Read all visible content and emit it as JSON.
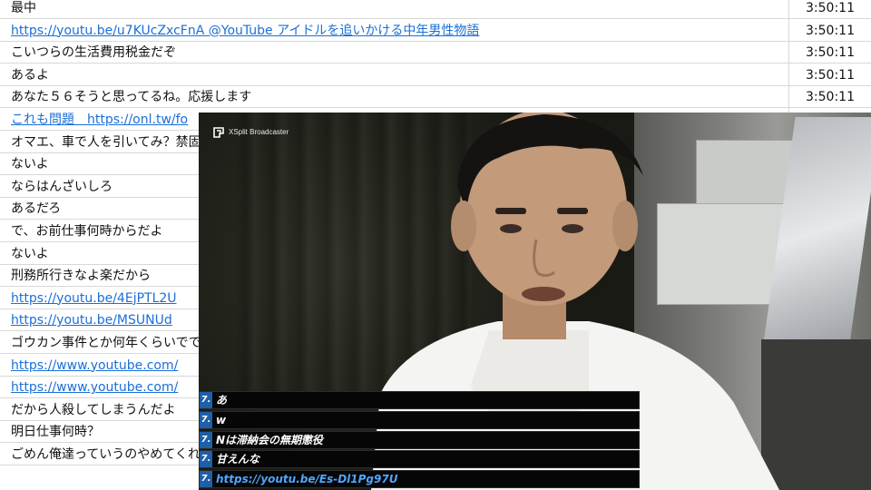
{
  "chat": {
    "rows": [
      {
        "text": "最中",
        "time": "3:50:11",
        "link": false
      },
      {
        "text": "https://youtu.be/u7KUcZxcFnA @YouTube アイドルを追いかける中年男性物語",
        "time": "3:50:11",
        "link": true
      },
      {
        "text": "こいつらの生活費用税金だぞ",
        "time": "3:50:11",
        "link": false
      },
      {
        "text": "あるよ",
        "time": "3:50:11",
        "link": false
      },
      {
        "text": "あなた５６そうと思ってるね。応援します",
        "time": "3:50:11",
        "link": false
      },
      {
        "text": "これも問題　https://onl.tw/fo",
        "time": "",
        "link": true
      },
      {
        "text": "オマエ、車で人を引いてみ？禁固",
        "time": "",
        "link": false
      },
      {
        "text": "ないよ",
        "time": "",
        "link": false
      },
      {
        "text": "ならはんざいしろ",
        "time": "",
        "link": false
      },
      {
        "text": "あるだろ",
        "time": "",
        "link": false
      },
      {
        "text": "で、お前仕事何時からだよ",
        "time": "",
        "link": false
      },
      {
        "text": "ないよ",
        "time": "",
        "link": false
      },
      {
        "text": "刑務所行きなよ楽だから",
        "time": "",
        "link": false
      },
      {
        "text": "https://youtu.be/4EjPTL2U",
        "time": "",
        "link": true
      },
      {
        "text": "https://youtu.be/MSUNUd",
        "time": "",
        "link": true
      },
      {
        "text": "ゴウカン事件とか何年くらいででて",
        "time": "",
        "link": false
      },
      {
        "text": "https://www.youtube.com/",
        "time": "",
        "link": true
      },
      {
        "text": "https://www.youtube.com/",
        "time": "",
        "link": true
      },
      {
        "text": "だから人殺してしまうんだよ",
        "time": "",
        "link": false
      },
      {
        "text": "明日仕事何時？",
        "time": "",
        "link": false
      },
      {
        "text": "ごめん俺達っていうのやめてくれない",
        "time": "",
        "link": false
      }
    ]
  },
  "video": {
    "watermark": "XSplit Broadcaster"
  },
  "live_comments": [
    {
      "text": "あ",
      "link": false
    },
    {
      "text": "w",
      "link": false
    },
    {
      "text": "Nは滞納会の無期懲役",
      "link": false
    },
    {
      "text": "甘えんな",
      "link": false
    },
    {
      "text": "https://youtu.be/Es-Dl1Pg97U",
      "link": true
    }
  ],
  "live_comment_mark": "7.",
  "colors": {
    "link": "#1a6fd8",
    "live_link": "#4fa6ff",
    "comment_mark": "#1e5fa8"
  }
}
